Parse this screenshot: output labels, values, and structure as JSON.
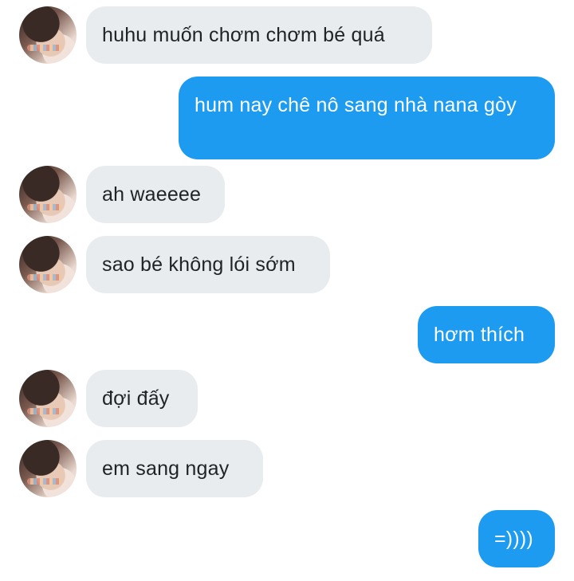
{
  "colors": {
    "incoming_bubble": "#e8ecef",
    "outgoing_bubble": "#1d9bf0",
    "incoming_text": "#1f2326",
    "outgoing_text": "#ffffff"
  },
  "messages": [
    {
      "direction": "incoming",
      "text": "huhu muốn chơm chơm bé quá"
    },
    {
      "direction": "outgoing",
      "text": "hum nay chê nô sang nhà nana gòy"
    },
    {
      "direction": "incoming",
      "text": "ah waeeee"
    },
    {
      "direction": "incoming",
      "text": "sao bé không lói sớm"
    },
    {
      "direction": "outgoing",
      "text": "hơm thích"
    },
    {
      "direction": "incoming",
      "text": "đợi đấy"
    },
    {
      "direction": "incoming",
      "text": "em sang ngay"
    },
    {
      "direction": "outgoing",
      "text": "=))))"
    }
  ]
}
